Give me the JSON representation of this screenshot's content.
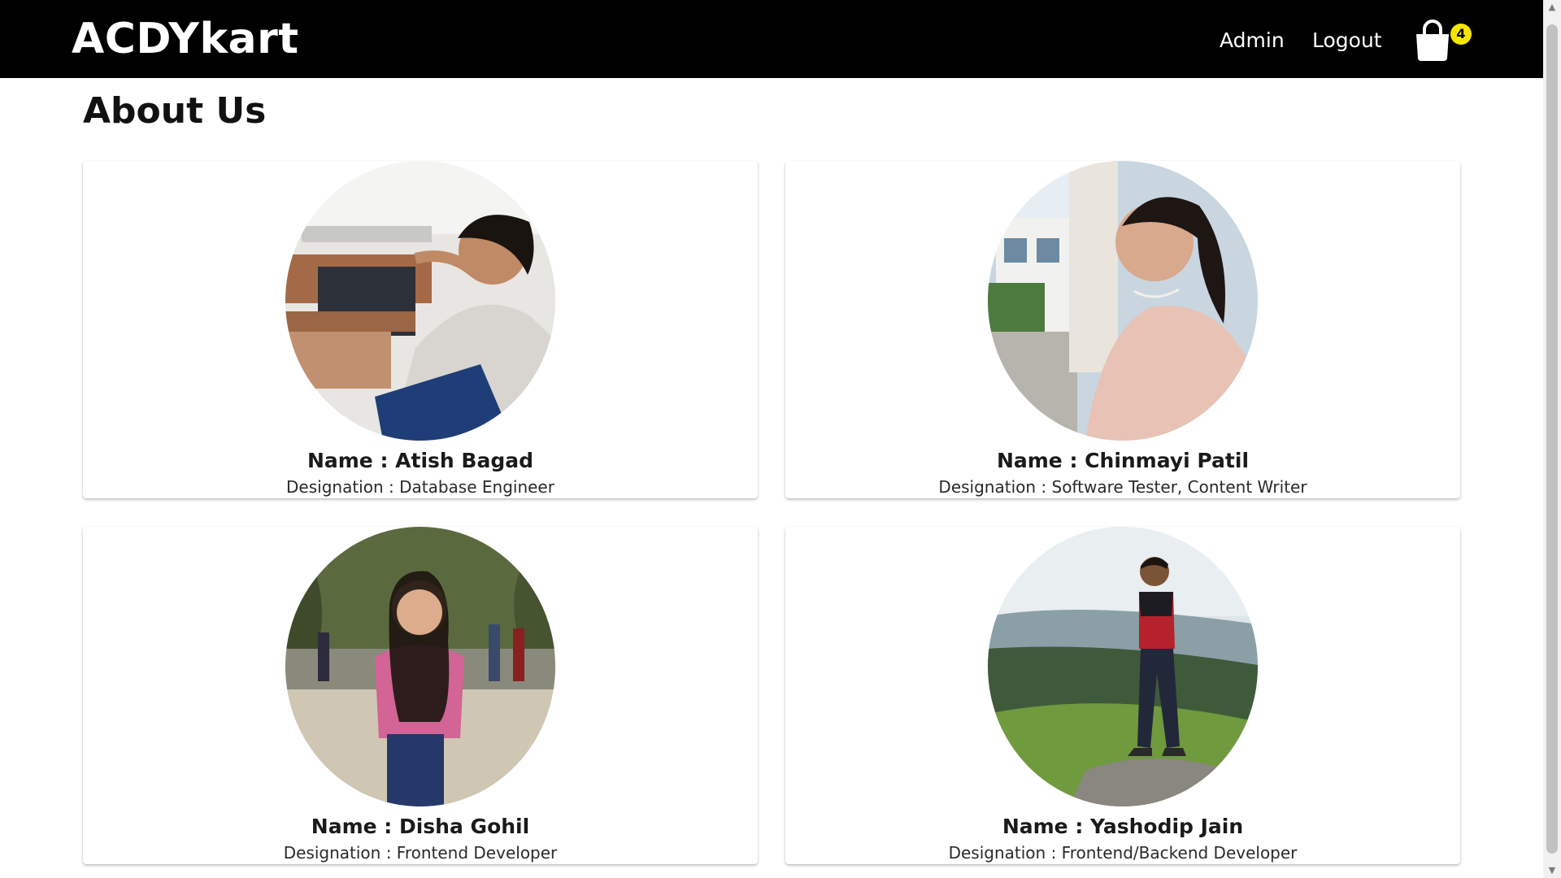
{
  "navbar": {
    "brand": "ACDYkart",
    "links": {
      "admin": "Admin",
      "logout": "Logout"
    },
    "cart": {
      "icon": "shopping-bag-icon",
      "count": "4",
      "badge_color": "#f5e600"
    },
    "background": "#000000"
  },
  "page": {
    "title": "About Us"
  },
  "team": [
    {
      "name": "Name : Atish Bagad",
      "designation": "Designation : Database Engineer"
    },
    {
      "name": "Name : Chinmayi Patil",
      "designation": "Designation : Software Tester, Content Writer"
    },
    {
      "name": "Name : Disha Gohil",
      "designation": "Designation : Frontend Developer"
    },
    {
      "name": "Name : Yashodip Jain",
      "designation": "Designation : Frontend/Backend Developer"
    }
  ],
  "scrollbar": {
    "up_icon": "scroll-up-arrow-icon",
    "down_icon": "scroll-down-arrow-icon"
  }
}
